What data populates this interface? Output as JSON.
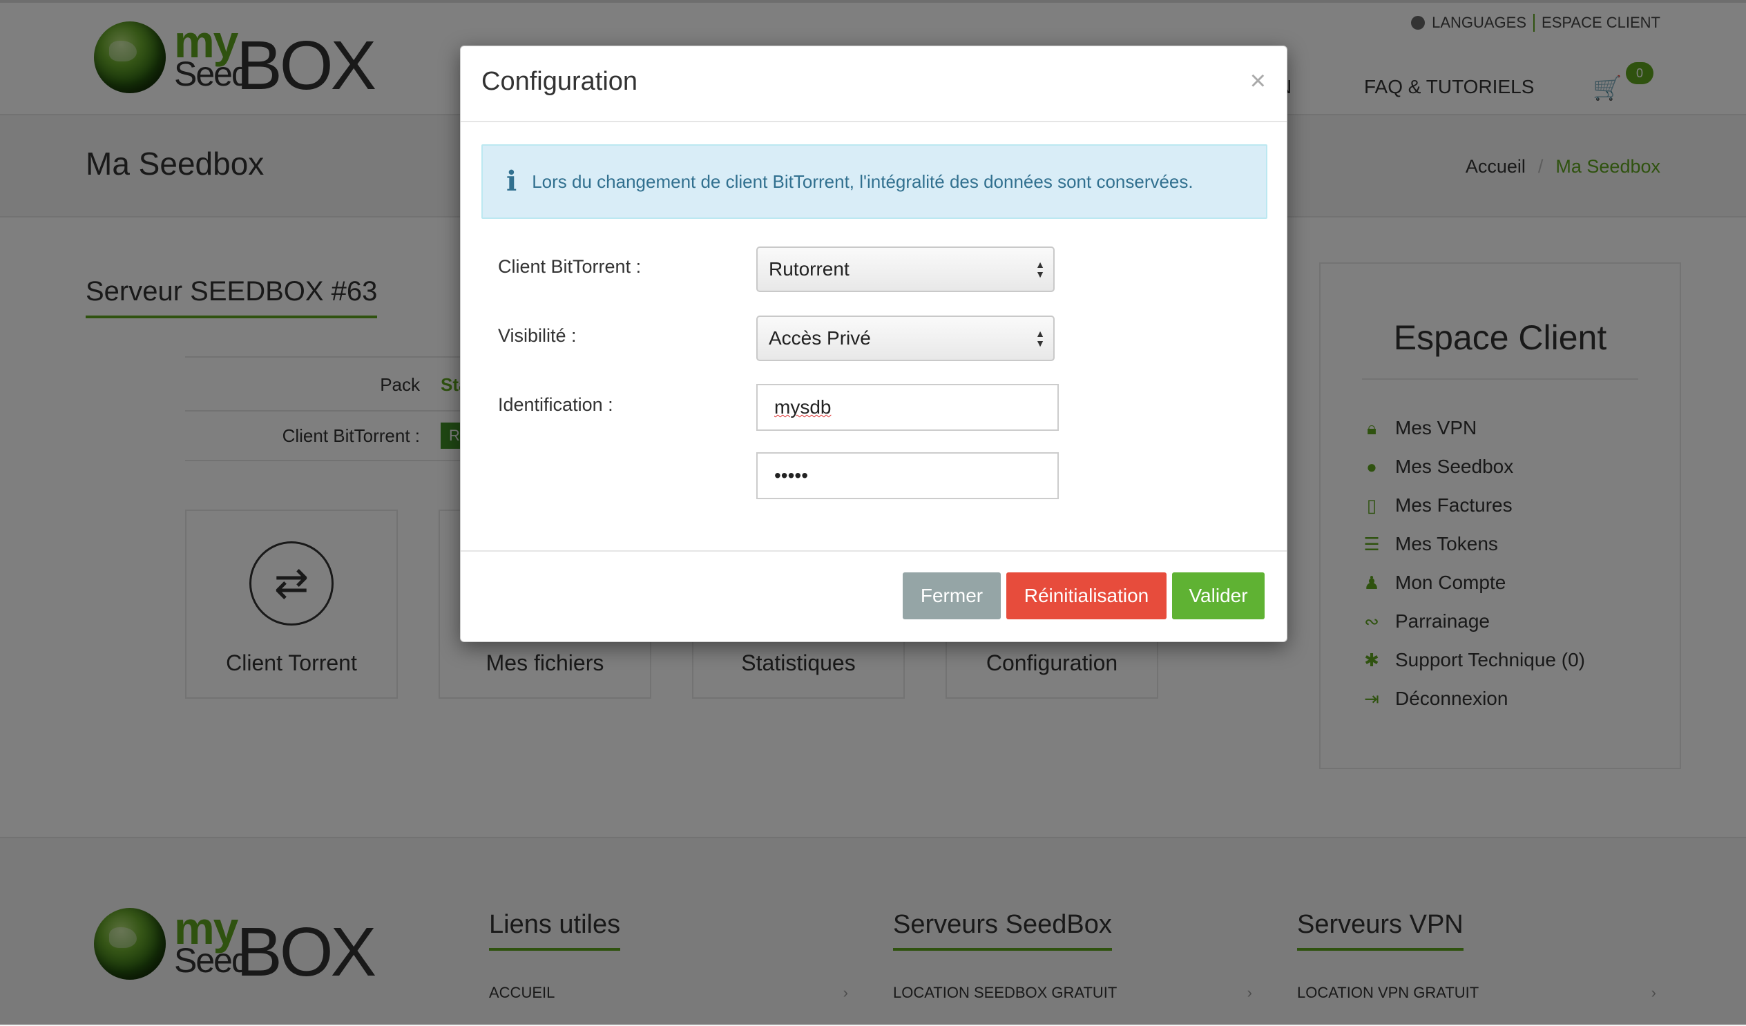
{
  "header": {
    "logo": {
      "my": "my",
      "seed": "Seed",
      "box": "BOX"
    },
    "languages": "LANGUAGES",
    "espace_client": "ESPACE CLIENT",
    "nav_partial": "N",
    "nav_faq": "FAQ & TUTORIELS",
    "cart_count": "0"
  },
  "titlebar": {
    "title": "Ma Seedbox",
    "breadcrumb": {
      "home": "Accueil",
      "separator": "/",
      "current": "Ma Seedbox"
    }
  },
  "server": {
    "title": "Serveur SEEDBOX #63",
    "pack_label": "Pack",
    "pack_value": "Start",
    "client_label": "Client BitTorrent :",
    "client_value": "Rutorrent"
  },
  "tiles": [
    "Client Torrent",
    "Mes fichiers",
    "Statistiques",
    "Configuration"
  ],
  "espace_client": {
    "title": "Espace Client",
    "items": [
      {
        "label": "Mes VPN",
        "icon": "lock-icon"
      },
      {
        "label": "Mes Seedbox",
        "icon": "globe-icon"
      },
      {
        "label": "Mes Factures",
        "icon": "document-icon"
      },
      {
        "label": "Mes Tokens",
        "icon": "database-icon"
      },
      {
        "label": "Mon Compte",
        "icon": "user-icon"
      },
      {
        "label": "Parrainage",
        "icon": "handshake-icon"
      },
      {
        "label": "Support Technique (0)",
        "icon": "bug-icon"
      },
      {
        "label": "Déconnexion",
        "icon": "sign-out-icon"
      }
    ],
    "accent_color": "#5ea51e"
  },
  "footer": {
    "cols": [
      {
        "title": "Liens utiles",
        "link": "ACCUEIL"
      },
      {
        "title": "Serveurs SeedBox",
        "link": "LOCATION SEEDBOX GRATUIT"
      },
      {
        "title": "Serveurs VPN",
        "link": "LOCATION VPN GRATUIT"
      }
    ]
  },
  "modal": {
    "title": "Configuration",
    "close": "×",
    "alert": "Lors du changement de client BitTorrent, l'intégralité des données sont conservées.",
    "client_label": "Client BitTorrent :",
    "client_value": "Rutorrent",
    "visibility_label": "Visibilité :",
    "visibility_value": "Accès Privé",
    "identification_label": "Identification :",
    "username": "mysdb",
    "password": "•••••",
    "buttons": {
      "fermer": "Fermer",
      "reinit": "Réinitialisation",
      "valider": "Valider"
    },
    "colors": {
      "fermer": "#95a5a6",
      "reinit": "#e74c3c",
      "valider": "#5fb233"
    }
  }
}
